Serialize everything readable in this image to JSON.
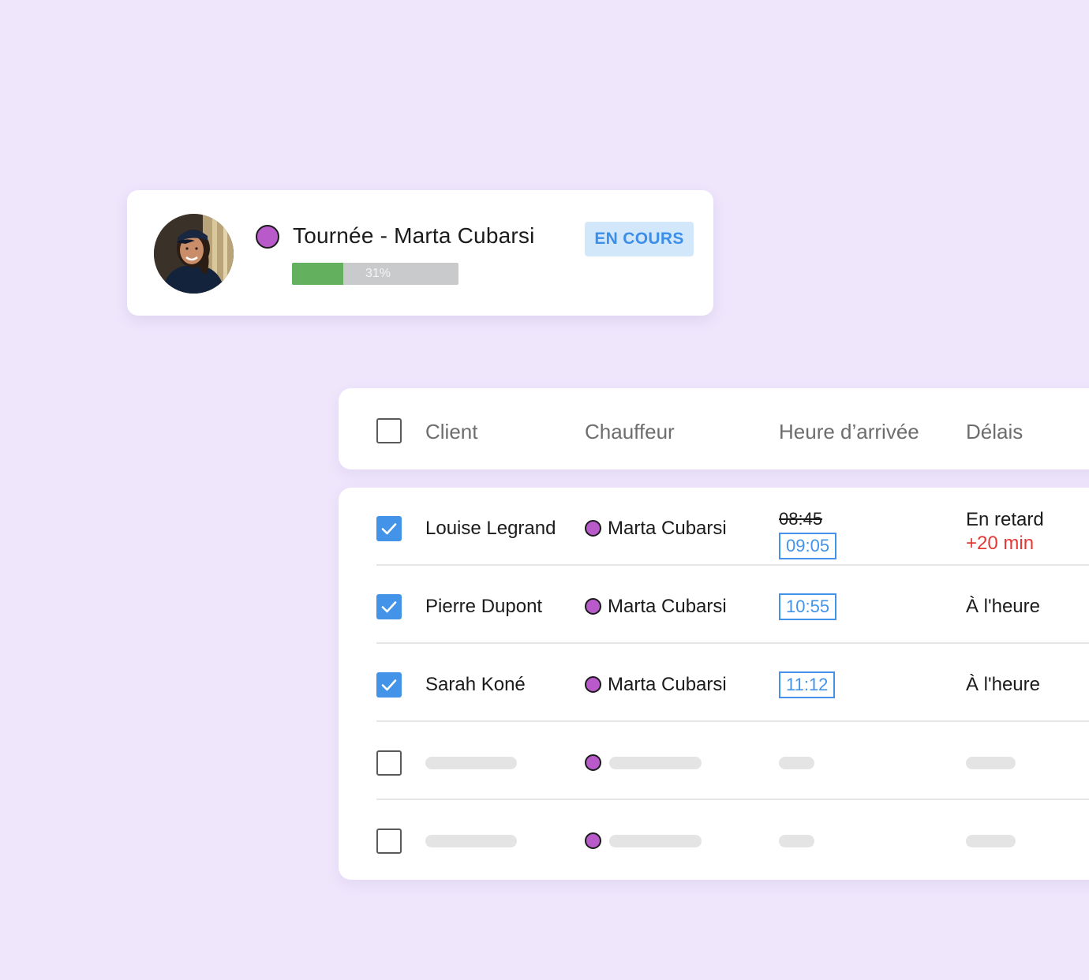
{
  "tour": {
    "title": "Tournée - Marta Cubarsi",
    "progress_percent": 31,
    "progress_label": "31%",
    "status": "EN COURS",
    "driver_color": "#b85ac9",
    "avatar_icon": "driver-photo"
  },
  "table": {
    "columns": {
      "client": "Client",
      "driver": "Chauffeur",
      "arrival": "Heure d’arrivée",
      "delay": "Délais"
    },
    "rows": [
      {
        "checked": true,
        "client": "Louise Legrand",
        "driver": "Marta Cubarsi",
        "time_old": "08:45",
        "time": "09:05",
        "delay": "En retard",
        "delay_extra": "+20 min"
      },
      {
        "checked": true,
        "client": "Pierre Dupont",
        "driver": "Marta Cubarsi",
        "time": "10:55",
        "delay": "À l'heure"
      },
      {
        "checked": true,
        "client": "Sarah Koné",
        "driver": "Marta Cubarsi",
        "time": "11:12",
        "delay": "À l'heure"
      },
      {
        "checked": false,
        "placeholder": true
      },
      {
        "checked": false,
        "placeholder": true
      }
    ]
  },
  "colors": {
    "background": "#efe6fc",
    "accent_blue": "#4394e8",
    "progress_green": "#63b05e",
    "late_red": "#e53935"
  }
}
